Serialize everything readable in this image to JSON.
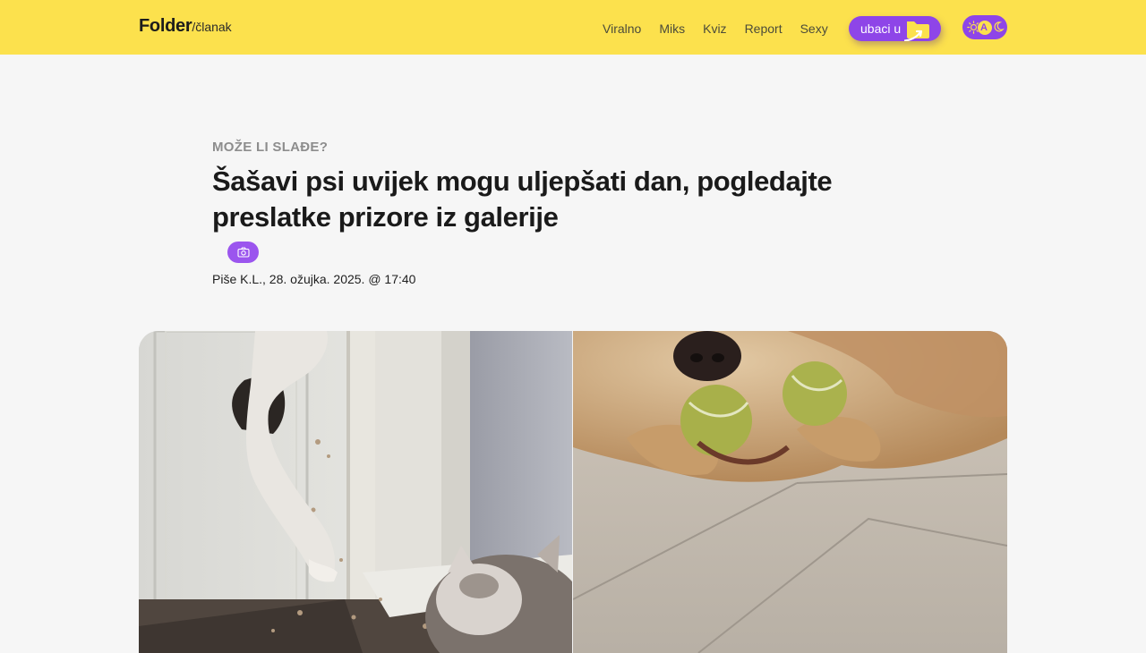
{
  "header": {
    "logo_main": "Folder",
    "logo_sub": "/članak",
    "nav": [
      "Viralno",
      "Miks",
      "Kviz",
      "Report",
      "Sexy"
    ],
    "cta_label": "ubaci u",
    "cta_icon": "folder-icon",
    "theme_toggle_icons": [
      "sun-icon",
      "auto-icon",
      "moon-icon"
    ],
    "theme_toggle_letter": "A"
  },
  "article": {
    "kicker": "MOŽE LI SLAĐE?",
    "title": "Šašavi psi uvijek mogu uljepšati dan, pogledajte preslatke prizore iz galerije",
    "badge_icon": "camera-icon",
    "byline": "Piše K.L., 28. ožujka. 2025. @ 17:40"
  },
  "hero": {
    "left_image": "dog-through-door-hole",
    "right_image": "dog-with-tennis-balls"
  },
  "colors": {
    "header_bg": "#fce14d",
    "accent": "#8e45e8",
    "page_bg": "#f6f6f6",
    "kicker": "#8d8d8d"
  }
}
